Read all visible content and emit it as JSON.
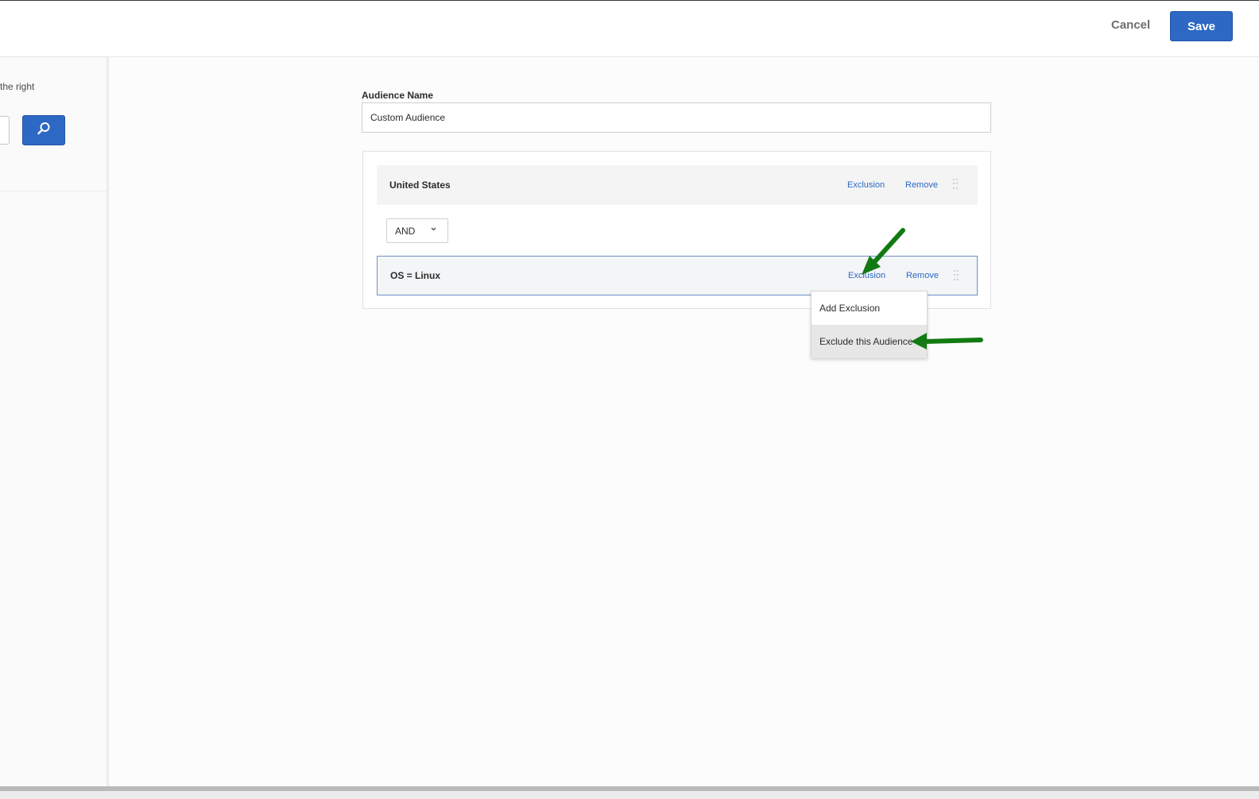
{
  "header": {
    "cancel_label": "Cancel",
    "save_label": "Save"
  },
  "left_panel": {
    "hint_text": "the right",
    "search_icon": "search-icon"
  },
  "form": {
    "audience_name_label": "Audience Name",
    "audience_name_value": "Custom Audience"
  },
  "rules": [
    {
      "title": "United States",
      "exclusion_label": "Exclusion",
      "remove_label": "Remove"
    },
    {
      "title": "OS = Linux",
      "exclusion_label": "Exclusion",
      "remove_label": "Remove"
    }
  ],
  "operator": {
    "selected": "AND",
    "chevron_icon": "chevron-down-icon"
  },
  "exclusion_menu": {
    "items": [
      "Add Exclusion",
      "Exclude this Audience"
    ],
    "highlighted_index": 1
  },
  "colors": {
    "primary": "#2d68c4",
    "annotation_arrow": "#127a12"
  }
}
